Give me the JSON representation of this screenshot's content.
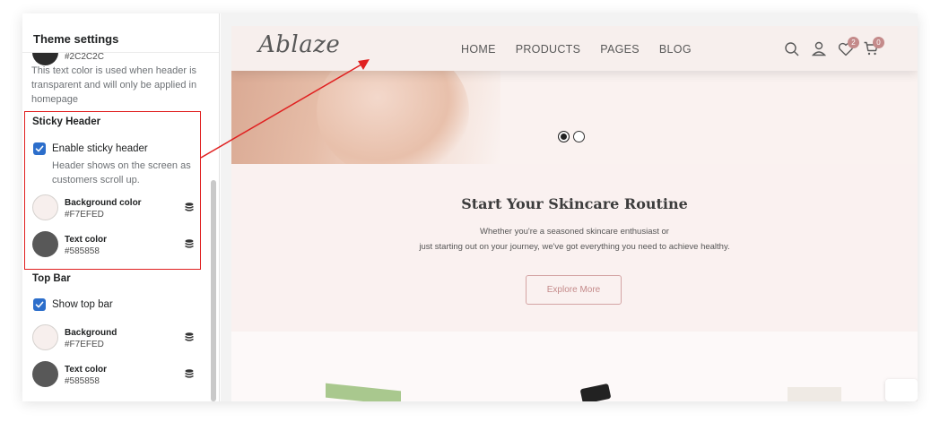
{
  "sidebar": {
    "title": "Theme settings",
    "top_hex": "#2C2C2C",
    "top_desc": "This text color is used when header is transparent and will only be applied in homepage",
    "sticky": {
      "title": "Sticky Header",
      "checkbox_label": "Enable sticky header",
      "checkbox_checked": true,
      "checkbox_desc": "Header shows on the screen as customers scroll up.",
      "fields": [
        {
          "label": "Background color",
          "hex": "#F7EFED",
          "color": "#F7EFED"
        },
        {
          "label": "Text color",
          "hex": "#585858",
          "color": "#585858"
        }
      ]
    },
    "topbar": {
      "title": "Top Bar",
      "checkbox_label": "Show top bar",
      "checkbox_checked": true,
      "fields": [
        {
          "label": "Background",
          "hex": "#F7EFED",
          "color": "#F7EFED"
        },
        {
          "label": "Text color",
          "hex": "#585858",
          "color": "#585858"
        }
      ]
    }
  },
  "preview": {
    "logo": "Ablaze",
    "nav": [
      "HOME",
      "PRODUCTS",
      "PAGES",
      "BLOG"
    ],
    "wishlist_count": "2",
    "cart_count": "0",
    "promo_title": "Start Your Skincare Routine",
    "promo_line1": "Whether you're a seasoned skincare enthusiast or",
    "promo_line2": "just starting out on your journey, we've got everything you need to achieve healthy.",
    "button_label": "Explore More"
  },
  "colors": {
    "accent": "#2C6ECB",
    "highlight": "#E02020",
    "badge": "#C48A8A"
  }
}
